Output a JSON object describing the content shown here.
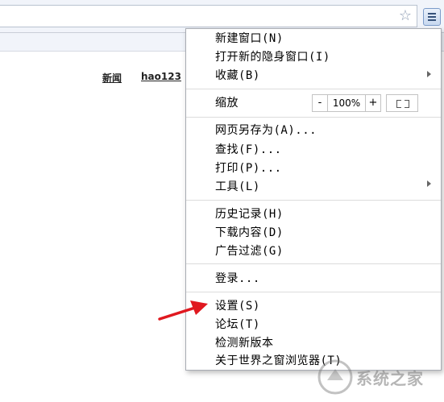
{
  "page": {
    "links": [
      "新闻",
      "hao123"
    ]
  },
  "menu": {
    "group1": [
      "新建窗口(N)",
      "打开新的隐身窗口(I)",
      "收藏(B)"
    ],
    "zoom": {
      "label": "缩放",
      "minus": "-",
      "value": "100%",
      "plus": "+"
    },
    "group2": [
      "网页另存为(A)...",
      "查找(F)...",
      "打印(P)...",
      "工具(L)"
    ],
    "group3": [
      "历史记录(H)",
      "下载内容(D)",
      "广告过滤(G)"
    ],
    "group4": [
      "登录..."
    ],
    "group5": [
      "设置(S)",
      "论坛(T)",
      "检测新版本",
      "关于世界之窗浏览器(T)"
    ]
  },
  "watermark": {
    "text": "系统之家"
  },
  "colors": {
    "accent": "#e0181f",
    "chrome": "#f1f4fa"
  },
  "icons": {
    "star": "star-icon",
    "menu": "menu-icon"
  }
}
